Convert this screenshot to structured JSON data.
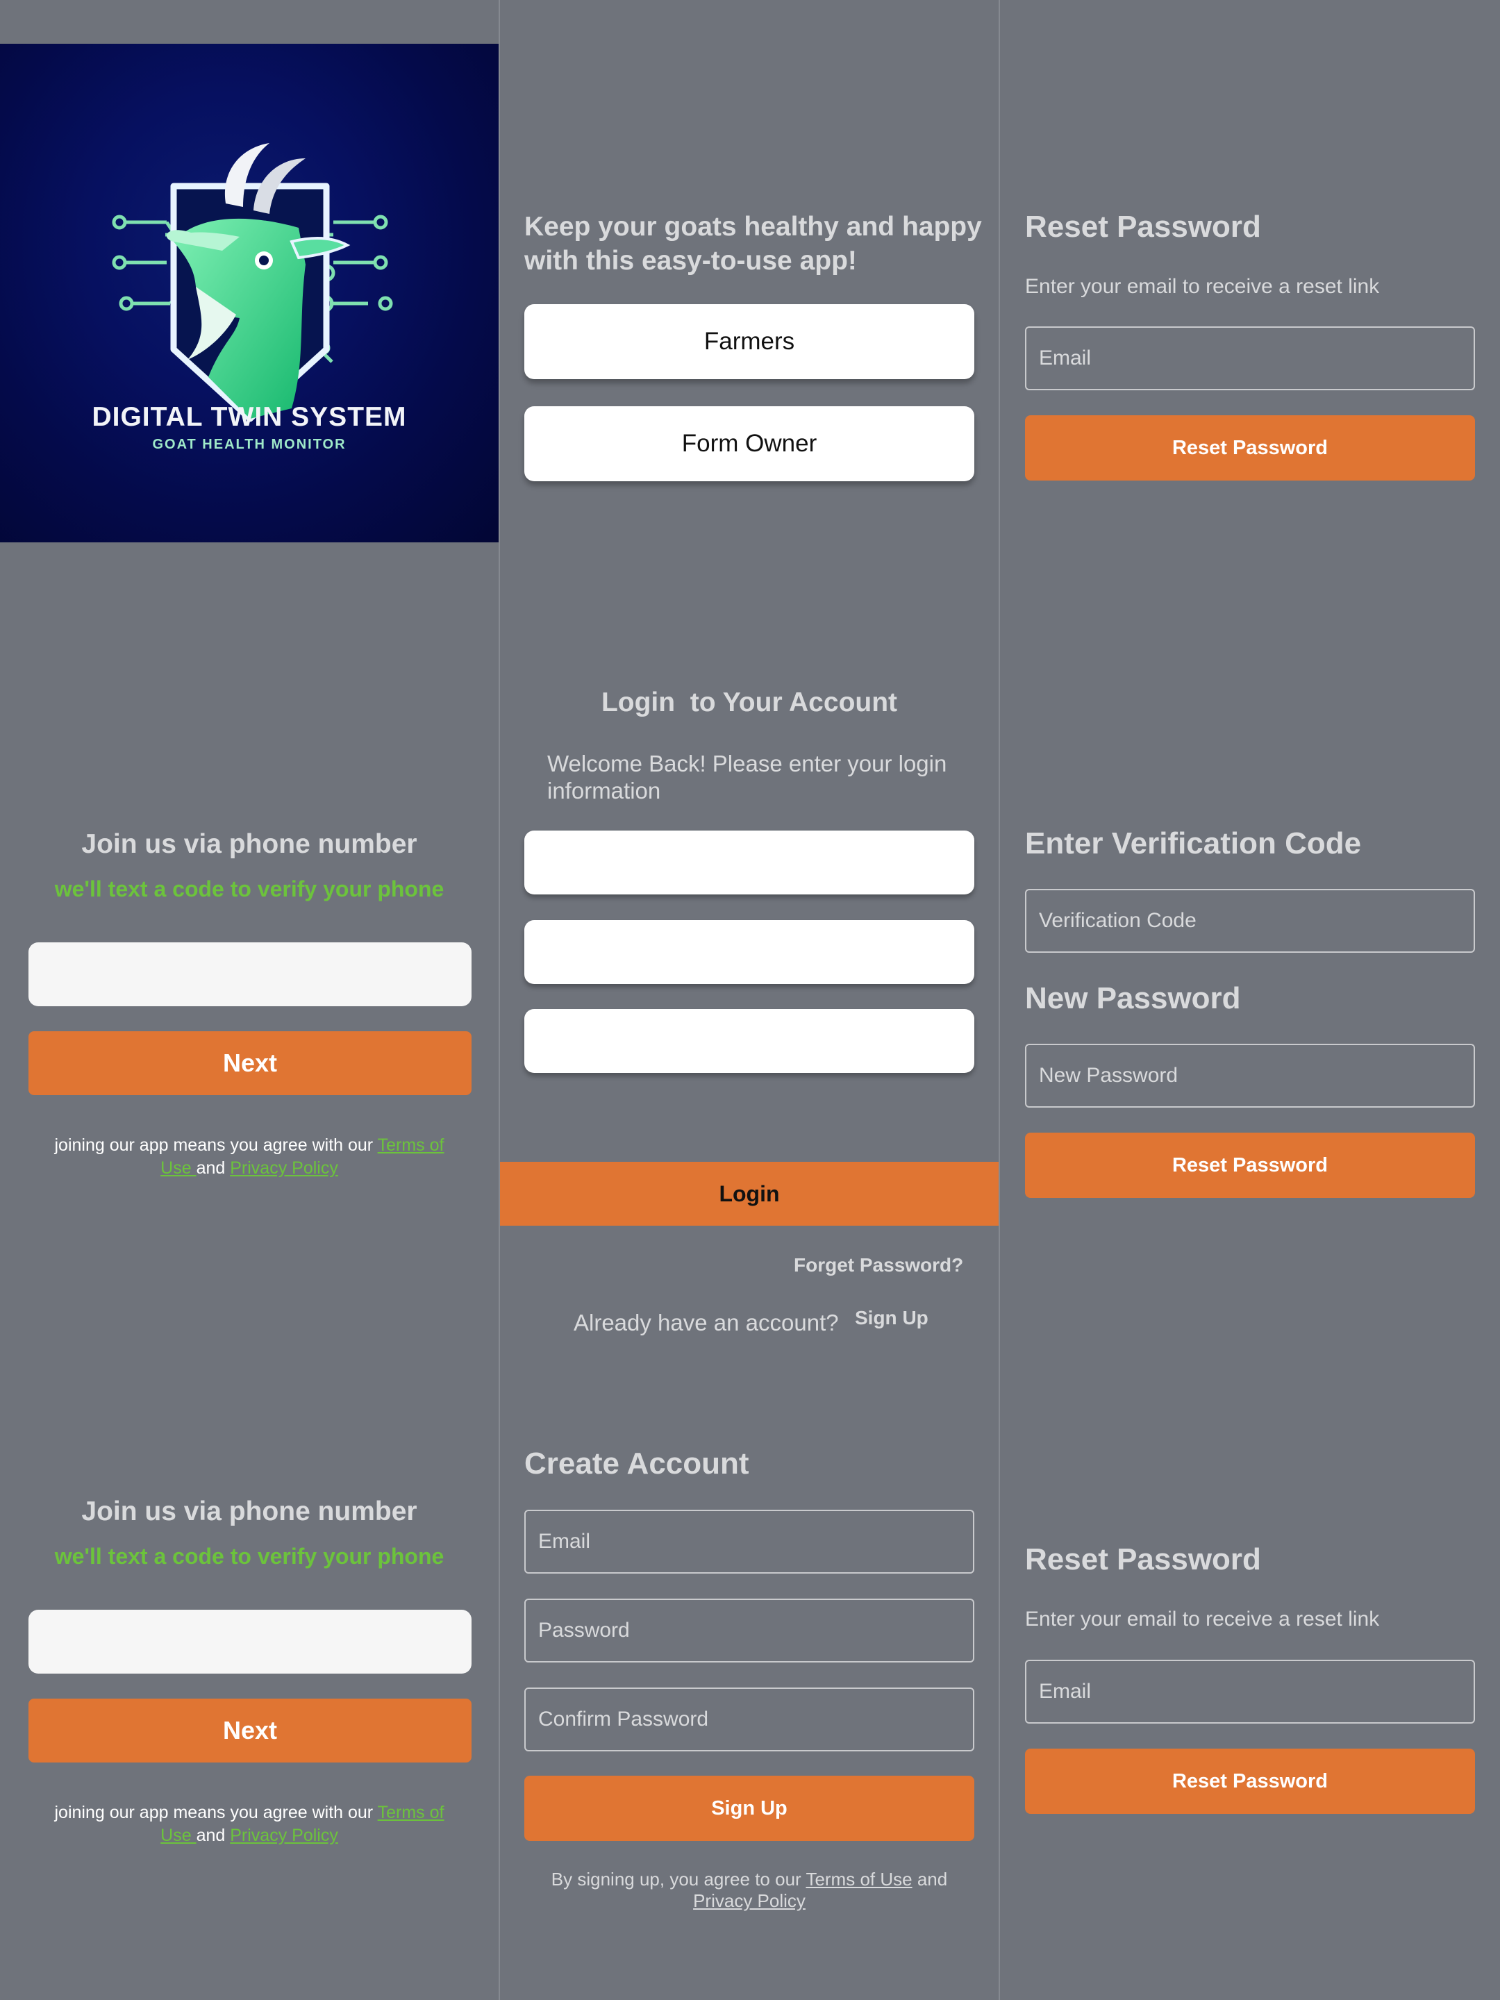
{
  "splash": {
    "logo_title": "DIGITAL TWIN SYSTEM",
    "logo_subtitle": "GOAT HEALTH MONITOR",
    "logo_icon": "goat-circuit-shield-icon"
  },
  "role_select": {
    "tagline": "Keep your goats healthy and happy with this easy-to-use app!",
    "farmers_label": "Farmers",
    "owner_label": "Form Owner"
  },
  "reset_top": {
    "title": "Reset Password",
    "subtitle": "Enter your email to receive a reset link",
    "email_placeholder": "Email",
    "button_label": "Reset Password"
  },
  "phone_join_1": {
    "title": "Join us via phone number",
    "subtitle": "we'll text a code to verify your phone",
    "next_label": "Next",
    "legal_prefix": "joining our app means you agree with our ",
    "terms_link": "Terms of Use ",
    "legal_and": " and ",
    "privacy_link": "Privacy Policy"
  },
  "login": {
    "title": "Login  to Your Account",
    "subtitle": "Welcome Back! Please enter your login information",
    "login_label": "Login",
    "forgot_label": "Forget Password?",
    "account_prompt": "Already have an account?",
    "signup_label": "Sign Up"
  },
  "verify": {
    "code_title": "Enter Verification Code",
    "code_placeholder": "Verification Code",
    "new_password_title": "New Password",
    "new_password_placeholder": "New Password",
    "button_label": "Reset Password"
  },
  "phone_join_2": {
    "title": "Join us via phone number",
    "subtitle": "we'll text a code to verify your phone",
    "next_label": "Next",
    "legal_prefix": "joining our app means you agree with our ",
    "terms_link": "Terms of Use ",
    "legal_and": " and ",
    "privacy_link": "Privacy Policy"
  },
  "signup": {
    "title": "Create Account",
    "email_placeholder": "Email",
    "password_placeholder": "Password",
    "confirm_placeholder": "Confirm Password",
    "button_label": "Sign Up",
    "legal_prefix": "By signing up, you agree to our ",
    "terms_link": "Terms of Use",
    "legal_and": " and",
    "privacy_link": "Privacy Policy"
  },
  "reset_bottom": {
    "title": "Reset Password",
    "subtitle": "Enter your email to receive a reset link",
    "email_placeholder": "Email",
    "button_label": "Reset Password"
  },
  "colors": {
    "background": "#6f737b",
    "accent_orange": "#e07533",
    "accent_green": "#6cc33c",
    "splash_navy": "#040a4a"
  }
}
